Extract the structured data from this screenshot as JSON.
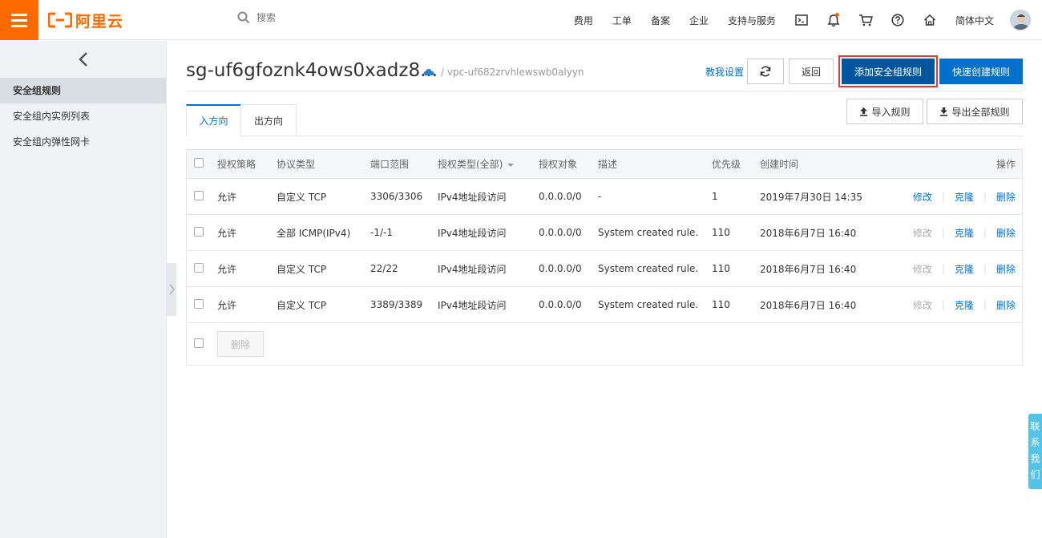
{
  "topbar": {
    "logo_text": "阿里云",
    "search_placeholder": "搜索",
    "nav": [
      "费用",
      "工单",
      "备案",
      "企业",
      "支持与服务"
    ],
    "language": "简体中文",
    "accent": "#ff6a00"
  },
  "sidebar": {
    "items": [
      "安全组规则",
      "安全组内实例列表",
      "安全组内弹性网卡"
    ],
    "active_index": 0
  },
  "header": {
    "title": "sg-uf6gfoznk4ows0xadz8...",
    "vpc_path": "/ vpc-uf682zrvhlewswb0alyyn",
    "teach_label": "教我设置",
    "back_label": "返回",
    "add_rule_label": "添加安全组规则",
    "quick_create_label": "快速创建规则"
  },
  "tabs": {
    "inbound": "入方向",
    "outbound": "出方向",
    "import_label": "导入规则",
    "export_label": "导出全部规则"
  },
  "table": {
    "columns": {
      "policy": "授权策略",
      "protocol": "协议类型",
      "port": "端口范围",
      "auth_type": "授权类型(全部)",
      "auth_obj": "授权对象",
      "desc": "描述",
      "priority": "优先级",
      "created": "创建时间",
      "ops": "操作"
    },
    "op_labels": {
      "edit": "修改",
      "clone": "克隆",
      "delete": "删除"
    },
    "rows": [
      {
        "policy": "允许",
        "protocol": "自定义 TCP",
        "port": "3306/3306",
        "auth_type": "IPv4地址段访问",
        "auth_obj": "0.0.0.0/0",
        "desc": "-",
        "priority": "1",
        "created": "2019年7月30日 14:35",
        "edit_enabled": true
      },
      {
        "policy": "允许",
        "protocol": "全部 ICMP(IPv4)",
        "port": "-1/-1",
        "auth_type": "IPv4地址段访问",
        "auth_obj": "0.0.0.0/0",
        "desc": "System created rule.",
        "priority": "110",
        "created": "2018年6月7日 16:40",
        "edit_enabled": false
      },
      {
        "policy": "允许",
        "protocol": "自定义 TCP",
        "port": "22/22",
        "auth_type": "IPv4地址段访问",
        "auth_obj": "0.0.0.0/0",
        "desc": "System created rule.",
        "priority": "110",
        "created": "2018年6月7日 16:40",
        "edit_enabled": false
      },
      {
        "policy": "允许",
        "protocol": "自定义 TCP",
        "port": "3389/3389",
        "auth_type": "IPv4地址段访问",
        "auth_obj": "0.0.0.0/0",
        "desc": "System created rule.",
        "priority": "110",
        "created": "2018年6月7日 16:40",
        "edit_enabled": false
      }
    ],
    "bulk_delete_label": "删除"
  },
  "contact": "联系我们"
}
